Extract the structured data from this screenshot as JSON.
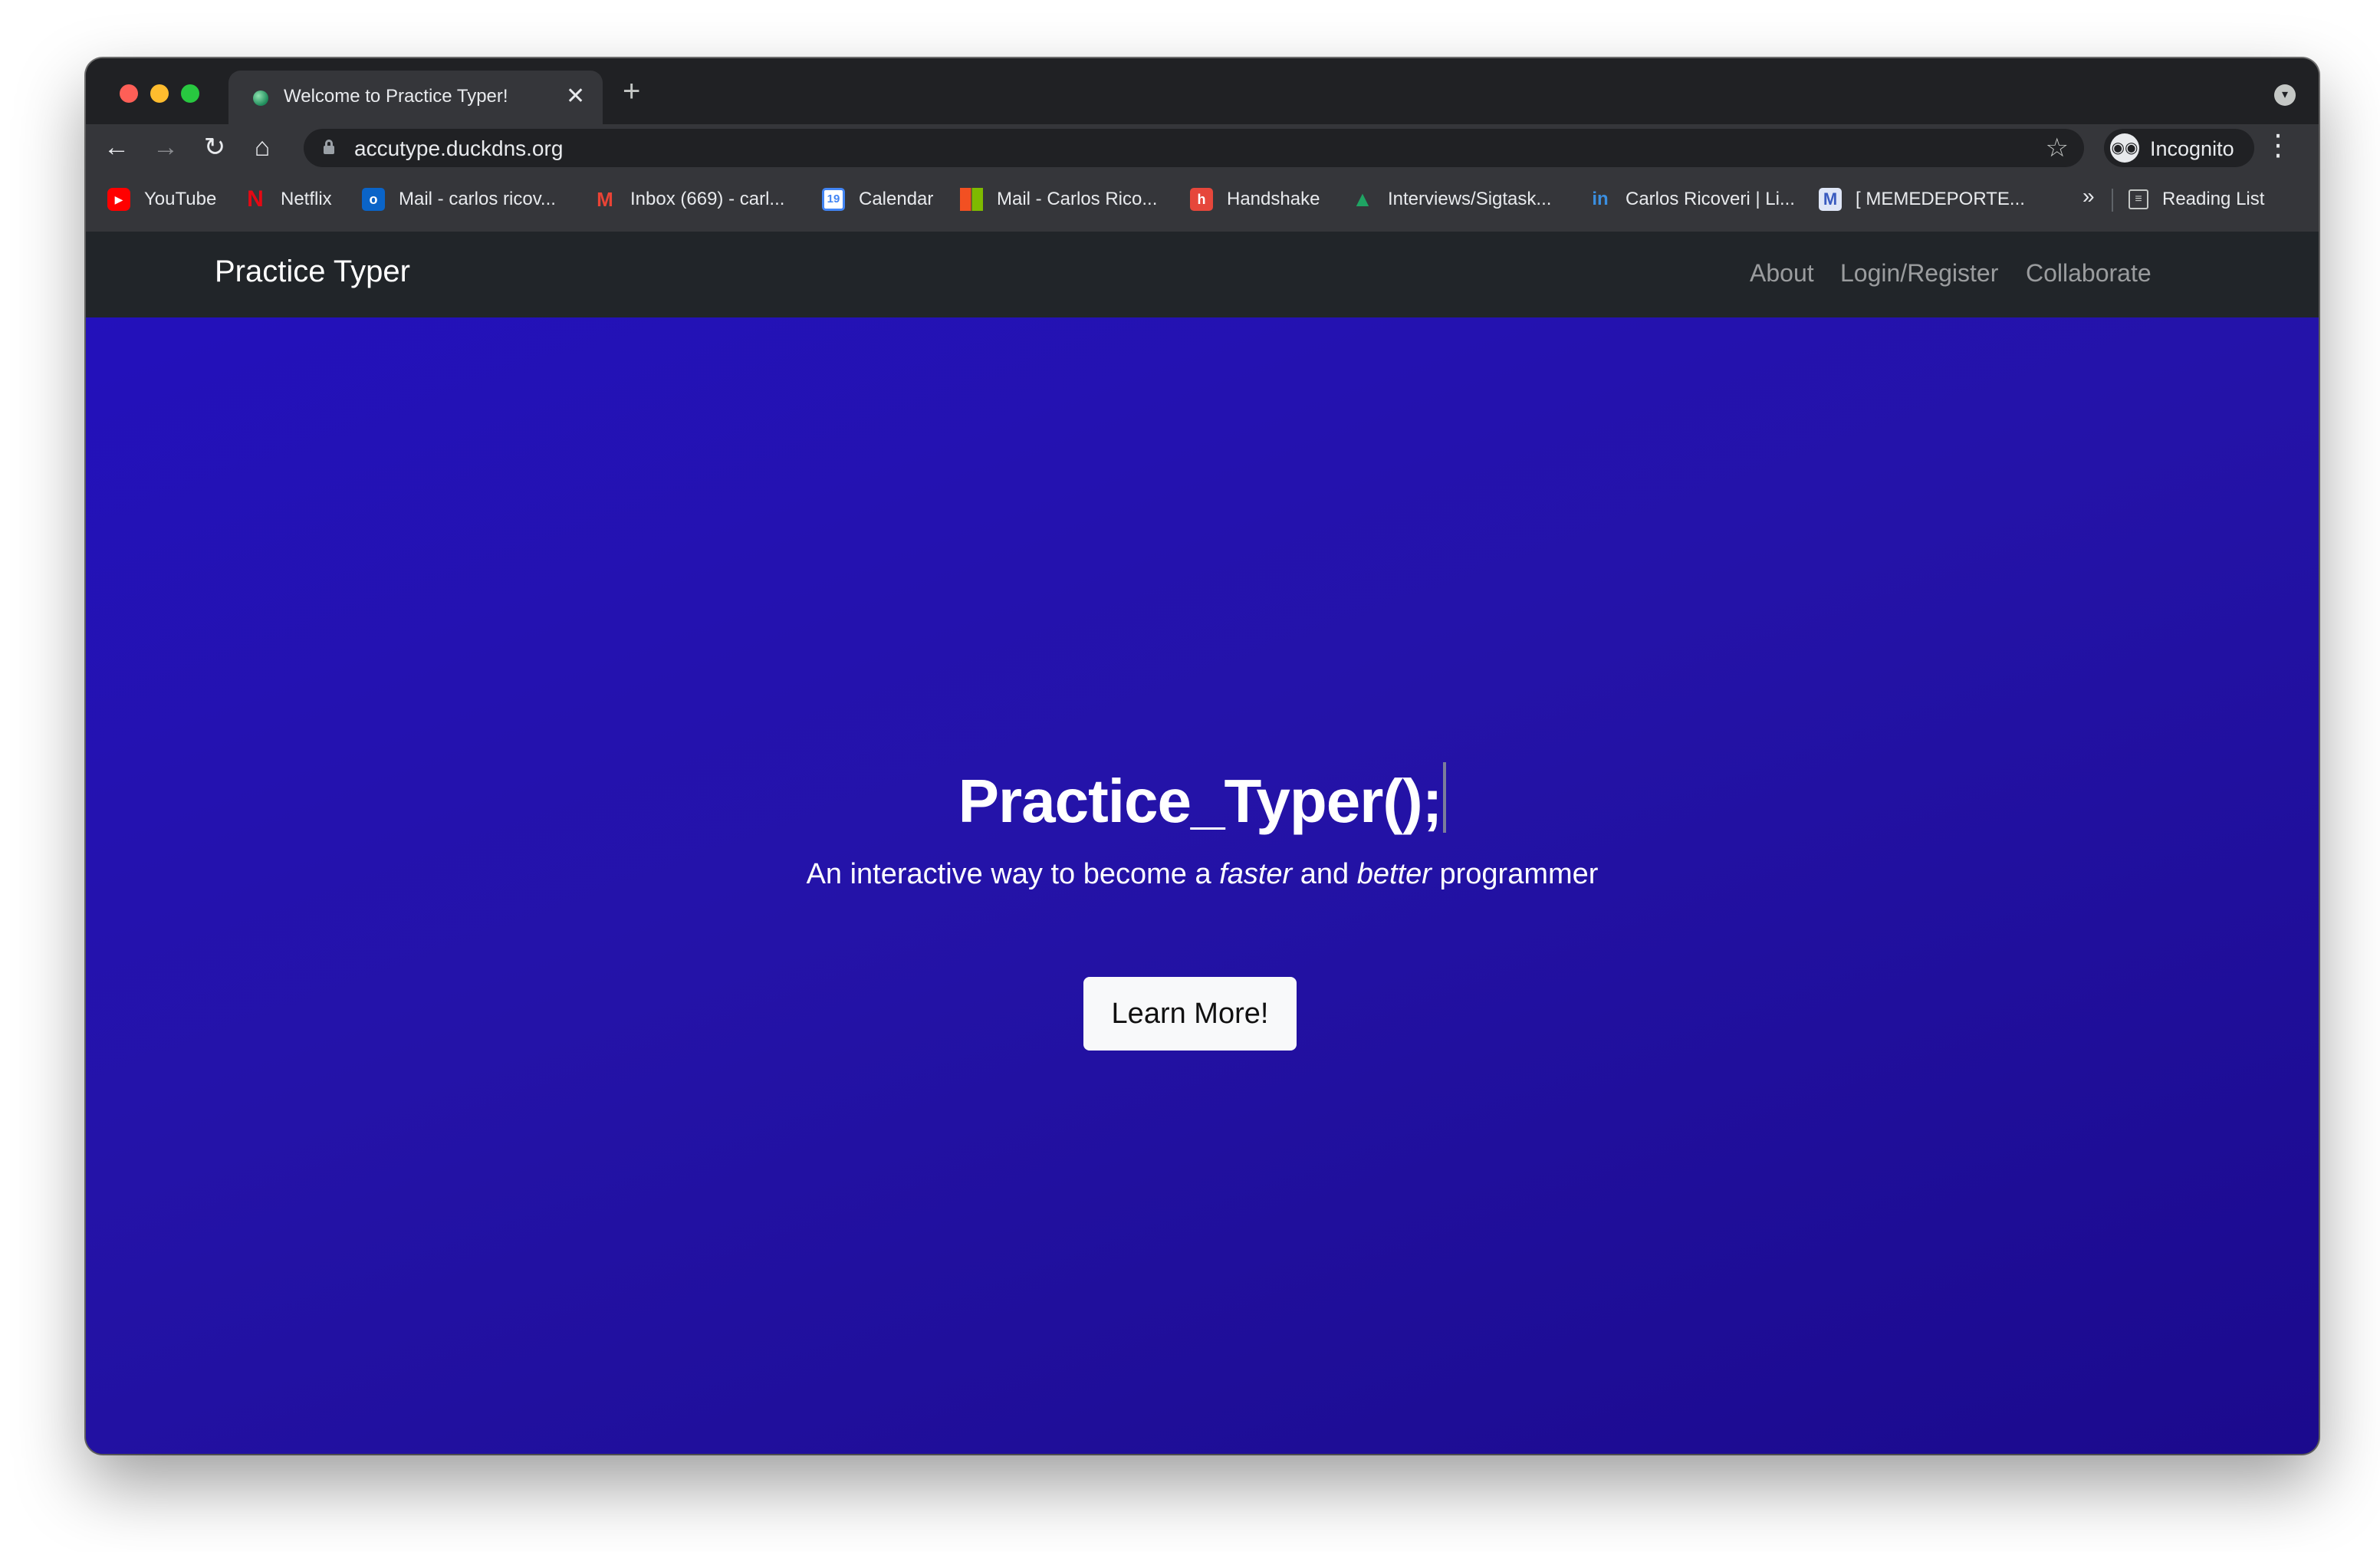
{
  "browser": {
    "tab_title": "Welcome to Practice Typer!",
    "tab_close": "✕",
    "new_tab": "+",
    "url": "accutype.duckdns.org",
    "profile_label": "Incognito",
    "reading_list_label": "Reading List",
    "bookmarks_overflow": "»",
    "icons": {
      "back": "back-arrow-icon",
      "forward": "forward-arrow-icon",
      "reload": "reload-icon",
      "home": "home-icon",
      "lock": "lock-icon",
      "star": "star-icon",
      "incognito": "incognito-icon",
      "menu": "three-dot-menu-icon",
      "tab_search": "tab-search-icon"
    },
    "bookmarks": [
      {
        "label": "YouTube",
        "icon": "youtube-icon",
        "color": "#ff0000"
      },
      {
        "label": "Netflix",
        "icon": "netflix-icon",
        "color": "#e50914"
      },
      {
        "label": "Mail - carlos ricov...",
        "icon": "outlook-icon",
        "color": "#0a64c8"
      },
      {
        "label": "Inbox (669) - carl...",
        "icon": "gmail-icon",
        "color": "#ea4335"
      },
      {
        "label": "Calendar",
        "icon": "calendar-icon",
        "color": "#4285f4"
      },
      {
        "label": "Mail - Carlos Rico...",
        "icon": "microsoft-icon",
        "color": "#f25022"
      },
      {
        "label": "Handshake",
        "icon": "handshake-icon",
        "color": "#e6473b"
      },
      {
        "label": "Interviews/Sigtask...",
        "icon": "google-drive-icon",
        "color": "#1fa463"
      },
      {
        "label": "Carlos Ricoveri | Li...",
        "icon": "linkedin-icon",
        "color": "#0a66c2"
      },
      {
        "label": "[ MEMEDEPORTE...",
        "icon": "memedeportes-icon",
        "color": "#6f8fd6"
      }
    ]
  },
  "site": {
    "brand": "Practice Typer",
    "nav": {
      "about": "About",
      "login": "Login/Register",
      "collaborate": "Collaborate"
    },
    "hero": {
      "title": "Practice_Typer();",
      "subtitle_pre": "An interactive way to become a ",
      "subtitle_em1": "faster",
      "subtitle_mid": " and ",
      "subtitle_em2": "better",
      "subtitle_post": " programmer",
      "cta_label": "Learn More!"
    },
    "colors": {
      "navbar_bg": "#212529",
      "hero_gradient_start": "#2311bb",
      "hero_gradient_end": "#1b0a8d",
      "cta_bg": "#f8f9fa"
    }
  }
}
